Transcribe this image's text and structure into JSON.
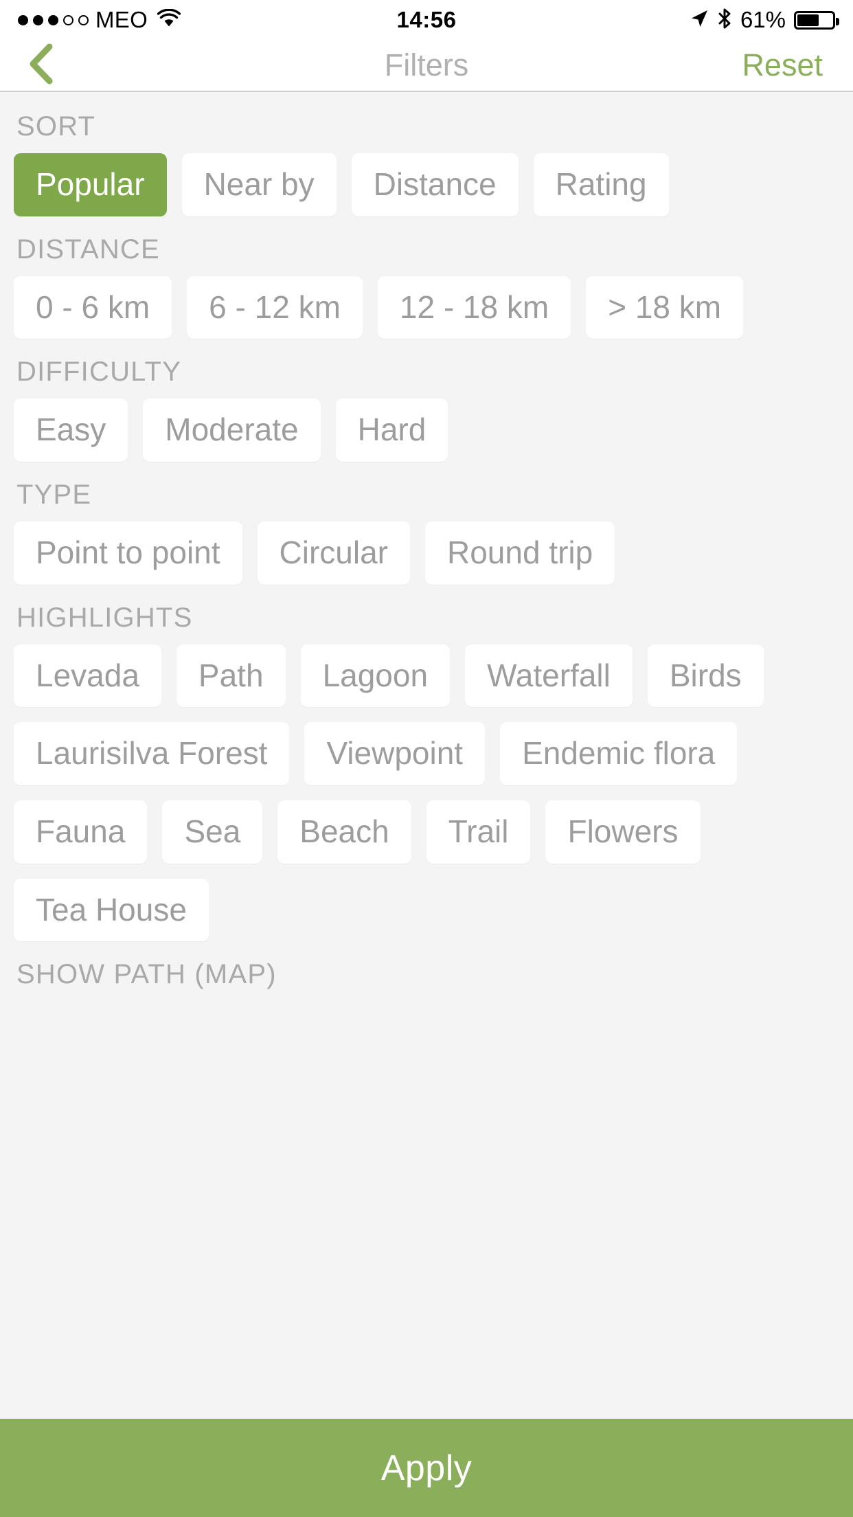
{
  "status_bar": {
    "signal_dots_filled": 3,
    "signal_dots_empty": 2,
    "carrier": "MEO",
    "wifi_icon": "wifi-icon",
    "time": "14:56",
    "location_icon": "location-arrow-icon",
    "bluetooth_icon": "bluetooth-icon",
    "battery_percent": "61%",
    "battery_level": 61
  },
  "nav": {
    "back_icon": "chevron-left-icon",
    "title": "Filters",
    "reset_label": "Reset"
  },
  "sections": [
    {
      "title": "SORT",
      "chips": [
        {
          "label": "Popular",
          "selected": true
        },
        {
          "label": "Near by",
          "selected": false
        },
        {
          "label": "Distance",
          "selected": false
        },
        {
          "label": "Rating",
          "selected": false
        }
      ]
    },
    {
      "title": "DISTANCE",
      "chips": [
        {
          "label": "0 - 6 km",
          "selected": false
        },
        {
          "label": "6 - 12 km",
          "selected": false
        },
        {
          "label": "12 - 18 km",
          "selected": false
        },
        {
          "label": "> 18 km",
          "selected": false
        }
      ]
    },
    {
      "title": "DIFFICULTY",
      "chips": [
        {
          "label": "Easy",
          "selected": false
        },
        {
          "label": "Moderate",
          "selected": false
        },
        {
          "label": "Hard",
          "selected": false
        }
      ]
    },
    {
      "title": "TYPE",
      "chips": [
        {
          "label": "Point to point",
          "selected": false
        },
        {
          "label": "Circular",
          "selected": false
        },
        {
          "label": "Round trip",
          "selected": false
        }
      ]
    },
    {
      "title": "HIGHLIGHTS",
      "chips": [
        {
          "label": "Levada",
          "selected": false
        },
        {
          "label": "Path",
          "selected": false
        },
        {
          "label": "Lagoon",
          "selected": false
        },
        {
          "label": "Waterfall",
          "selected": false
        },
        {
          "label": "Birds",
          "selected": false
        },
        {
          "label": "Laurisilva Forest",
          "selected": false
        },
        {
          "label": "Viewpoint",
          "selected": false
        },
        {
          "label": "Endemic flora",
          "selected": false
        },
        {
          "label": "Fauna",
          "selected": false
        },
        {
          "label": "Sea",
          "selected": false
        },
        {
          "label": "Beach",
          "selected": false
        },
        {
          "label": "Trail",
          "selected": false
        },
        {
          "label": "Flowers",
          "selected": false
        },
        {
          "label": "Tea House",
          "selected": false
        }
      ]
    },
    {
      "title": "SHOW PATH (MAP)",
      "chips": []
    }
  ],
  "footer": {
    "apply_label": "Apply"
  },
  "colors": {
    "accent_green": "#8aae5a",
    "selected_chip_green": "#7fa84a",
    "page_background": "#f4f4f4",
    "chip_background": "#ffffff",
    "chip_text": "#9d9d9d",
    "section_title": "#a9a9a9"
  }
}
